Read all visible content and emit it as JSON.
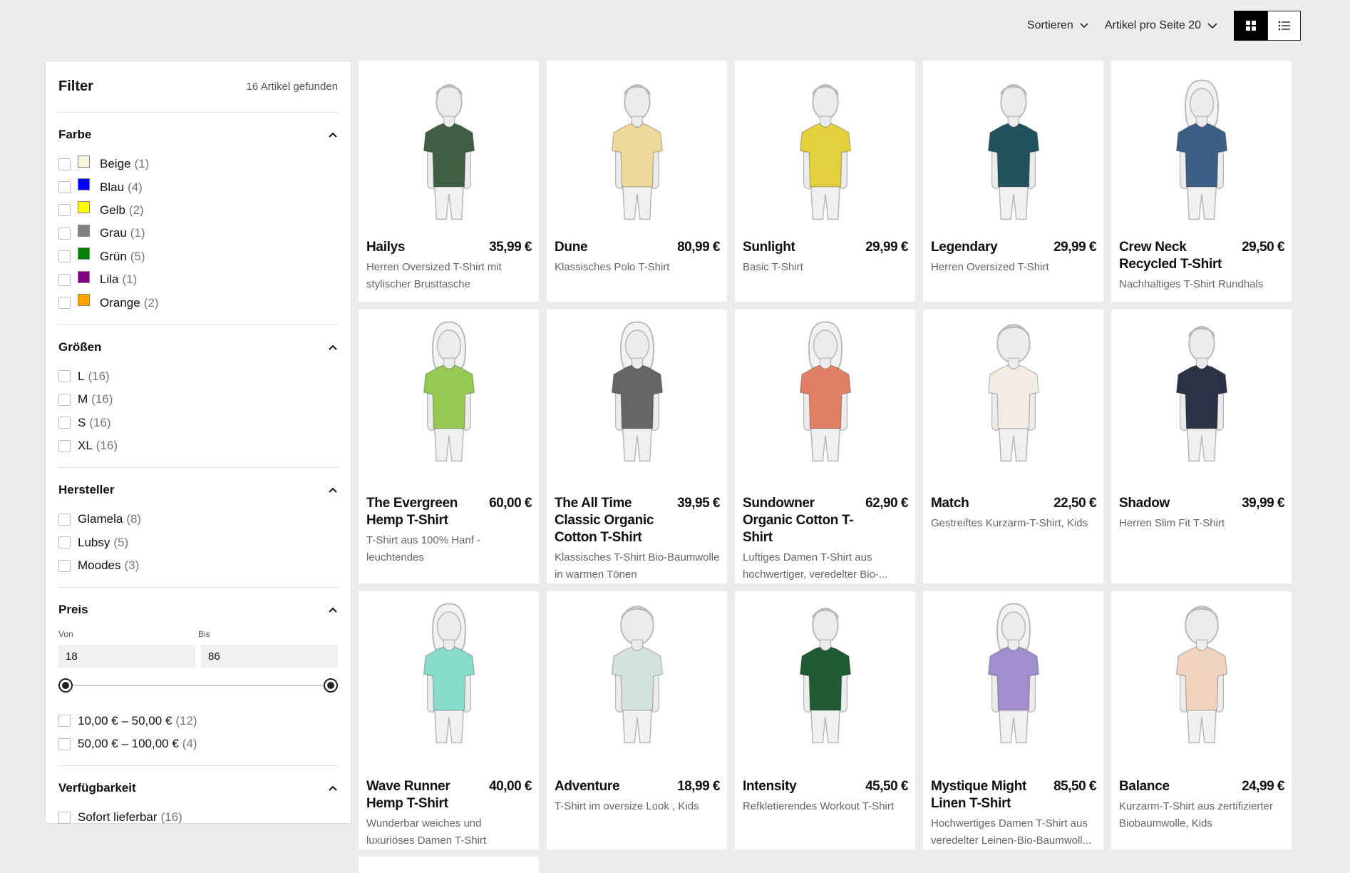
{
  "toolbar": {
    "sort_label": "Sortieren",
    "per_page_label": "Artikel pro Seite 20"
  },
  "filter": {
    "title": "Filter",
    "found": "16 Artikel gefunden",
    "color": {
      "title": "Farbe",
      "options": [
        {
          "label": "Beige",
          "count": "(1)",
          "color": "#f5f5dc"
        },
        {
          "label": "Blau",
          "count": "(4)",
          "color": "#0000ff"
        },
        {
          "label": "Gelb",
          "count": "(2)",
          "color": "#ffff00"
        },
        {
          "label": "Grau",
          "count": "(1)",
          "color": "#808080"
        },
        {
          "label": "Grün",
          "count": "(5)",
          "color": "#008000"
        },
        {
          "label": "Lila",
          "count": "(1)",
          "color": "#800080"
        },
        {
          "label": "Orange",
          "count": "(2)",
          "color": "#ffa500"
        }
      ]
    },
    "sizes": {
      "title": "Größen",
      "options": [
        {
          "label": "L",
          "count": "(16)"
        },
        {
          "label": "M",
          "count": "(16)"
        },
        {
          "label": "S",
          "count": "(16)"
        },
        {
          "label": "XL",
          "count": "(16)"
        }
      ]
    },
    "brands": {
      "title": "Hersteller",
      "options": [
        {
          "label": "Glamela",
          "count": "(8)"
        },
        {
          "label": "Lubsy",
          "count": "(5)"
        },
        {
          "label": "Moodes",
          "count": "(3)"
        }
      ]
    },
    "price": {
      "title": "Preis",
      "from_label": "Von",
      "to_label": "Bis",
      "from_value": "18",
      "to_value": "86",
      "options": [
        {
          "label": "10,00 € – 50,00 €",
          "count": "(12)"
        },
        {
          "label": "50,00 € – 100,00 €",
          "count": "(4)"
        }
      ]
    },
    "availability": {
      "title": "Verfügbarkeit",
      "options": [
        {
          "label": "Sofort lieferbar",
          "count": "(16)"
        }
      ]
    }
  },
  "products": [
    {
      "name": "Hailys",
      "price": "35,99 €",
      "desc": "Herren Oversized T-Shirt mit stylischer Brusttasche",
      "shirt": "#3f5f43",
      "fig": "male"
    },
    {
      "name": "Dune",
      "price": "80,99 €",
      "desc": "Klassisches Polo T-Shirt",
      "shirt": "#efd99a",
      "fig": "male"
    },
    {
      "name": "Sunlight",
      "price": "29,99 €",
      "desc": "Basic T-Shirt",
      "shirt": "#e4cf3c",
      "fig": "male"
    },
    {
      "name": "Legendary",
      "price": "29,99 €",
      "desc": "Herren Oversized T-Shirt",
      "shirt": "#23525f",
      "fig": "male"
    },
    {
      "name": "Crew Neck Recycled T-Shirt",
      "price": "29,50 €",
      "desc": "Nachhaltiges T-Shirt Rundhals",
      "shirt": "#3c5f85",
      "fig": "female"
    },
    {
      "name": "The Evergreen Hemp T-Shirt",
      "price": "60,00 €",
      "desc": "T-Shirt aus 100% Hanf - leuchtendes",
      "shirt": "#97c851",
      "fig": "female"
    },
    {
      "name": "The All Time Classic Organic Cotton T-Shirt",
      "price": "39,95 €",
      "desc": "Klassisches T-Shirt Bio-Baumwolle in warmen Tönen",
      "shirt": "#666666",
      "fig": "female"
    },
    {
      "name": "Sundowner Organic Cotton T-Shirt",
      "price": "62,90 €",
      "desc": "Luftiges Damen T-Shirt aus hochwertiger, veredelter Bio-...",
      "shirt": "#e07f63",
      "fig": "female"
    },
    {
      "name": "Match",
      "price": "22,50 €",
      "desc": "Gestreiftes Kurzarm-T-Shirt, Kids",
      "shirt": "#f3ece2",
      "fig": "kid"
    },
    {
      "name": "Shadow",
      "price": "39,99 €",
      "desc": "Herren Slim Fit T-Shirt",
      "shirt": "#2b3245",
      "fig": "male"
    },
    {
      "name": "Wave Runner Hemp T-Shirt",
      "price": "40,00 €",
      "desc": "Wunderbar weiches und luxuriöses Damen T-Shirt",
      "shirt": "#88dccb",
      "fig": "female"
    },
    {
      "name": "Adventure",
      "price": "18,99 €",
      "desc": "T-Shirt im oversize Look , Kids",
      "shirt": "#d4e2dc",
      "fig": "kid"
    },
    {
      "name": "Intensity",
      "price": "45,50 €",
      "desc": "Refkletierendes Workout T-Shirt",
      "shirt": "#1f5c34",
      "fig": "male"
    },
    {
      "name": "Mystique Might Linen T-Shirt",
      "price": "85,50 €",
      "desc": "Hochwertiges Damen T-Shirt aus veredelter Leinen-Bio-Baumwoll...",
      "shirt": "#a08fcc",
      "fig": "female"
    },
    {
      "name": "Balance",
      "price": "24,99 €",
      "desc": "Kurzarm-T-Shirt aus zertifizierter Biobaumwolle, Kids",
      "shirt": "#f1d2bf",
      "fig": "kid"
    }
  ]
}
